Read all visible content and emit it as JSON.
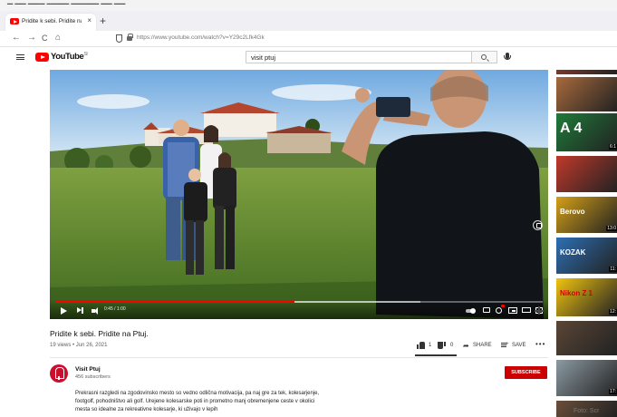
{
  "browser": {
    "tab_title": "Pridite k sebi. Pridite na Ptuj. - ",
    "tab_close": "×",
    "new_tab": "+",
    "back": "←",
    "forward": "→",
    "reload": "C",
    "home": "⌂",
    "url": "https://www.youtube.com/watch?v=Y29c2Lfk4Gk"
  },
  "youtube": {
    "logo_text": "YouTube",
    "logo_sup": "SI",
    "search_value": "visit ptuj"
  },
  "player": {
    "time": "0:45 / 1:00",
    "progress": 0.49,
    "buffered": 0.75
  },
  "video": {
    "title": "Pridite k sebi. Pridite na Ptuj.",
    "meta": "19 views • Jun 26, 2021",
    "likes": "1",
    "dislikes": "0",
    "share_label": "SHARE",
    "save_label": "SAVE",
    "more": "•••",
    "like_ratio": 1.0
  },
  "channel": {
    "name": "Visit Ptuj",
    "subscribers": "456 subscribers",
    "subscribe_label": "SUBSCRIBE",
    "description": "Prekrasni razgledi na zgodovinsko mesto so vedno odlična motivacija, pa naj gre za tek, kolesarjenje, footgolf, pohodništvo ali golf. Urejene kolesarske poti in prometno manj obremenjene ceste v okolici mesta so idealne za rekreativne kolesarje, ki uživajo v lepih"
  },
  "sidebar": {
    "thumbs": [
      {
        "label": "",
        "duration": "",
        "bg": "#7b3b2a"
      },
      {
        "label": "",
        "duration": "",
        "bg": "#a86a3c"
      },
      {
        "label": "A 4",
        "duration": "6:1",
        "bg": "#1f7a3a"
      },
      {
        "label": "",
        "duration": "",
        "bg": "#c0392b"
      },
      {
        "label": "Berovo",
        "duration": "13:0",
        "bg": "#d4a017"
      },
      {
        "label": "KOZAK",
        "duration": "11:",
        "bg": "#2d6fb3"
      },
      {
        "label": "Nikon Z 1",
        "duration": "12:",
        "bg": "#f1c40f"
      },
      {
        "label": "",
        "duration": "",
        "bg": "#5a4636"
      },
      {
        "label": "",
        "duration": "17:",
        "bg": "#8c9aa3"
      },
      {
        "label": "",
        "duration": "",
        "bg": "#6b4f3a"
      }
    ]
  },
  "watermark": "Foto: Scr"
}
